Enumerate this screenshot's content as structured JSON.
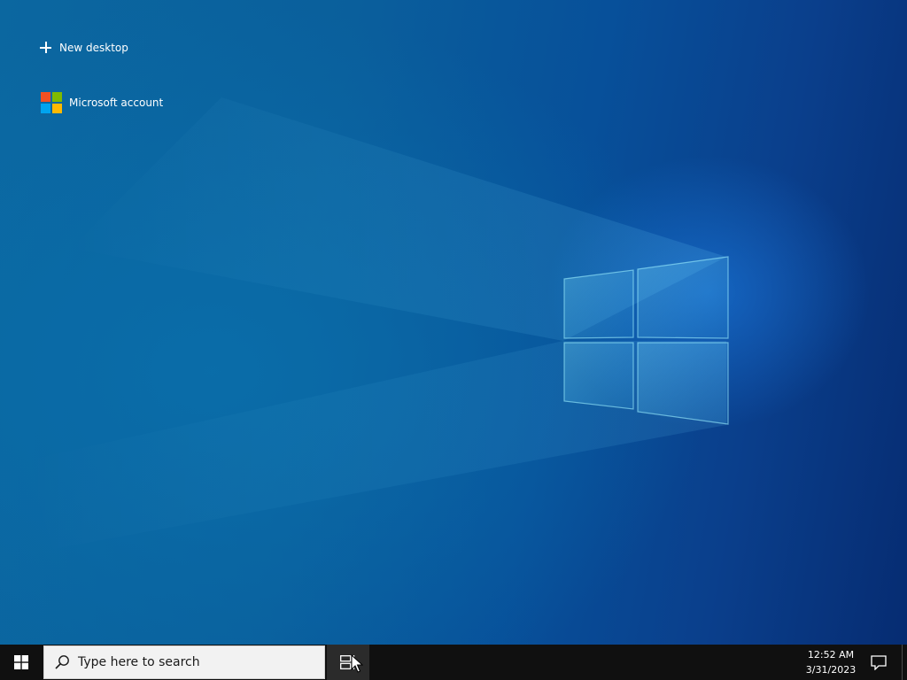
{
  "timeline": {
    "new_desktop_label": "New desktop",
    "account_label": "Microsoft account",
    "account_logo_colors": [
      "#f25022",
      "#7fba00",
      "#00a4ef",
      "#ffb900"
    ]
  },
  "taskbar": {
    "search_placeholder": "Type here to search",
    "clock": {
      "time": "12:52 AM",
      "date": "3/31/2023"
    }
  },
  "colors": {
    "taskbar_bg": "#101010",
    "search_bg": "#f2f2f2",
    "taskview_active_bg": "#2b2b2b",
    "wallpaper_blue": "#0a5f9c"
  }
}
